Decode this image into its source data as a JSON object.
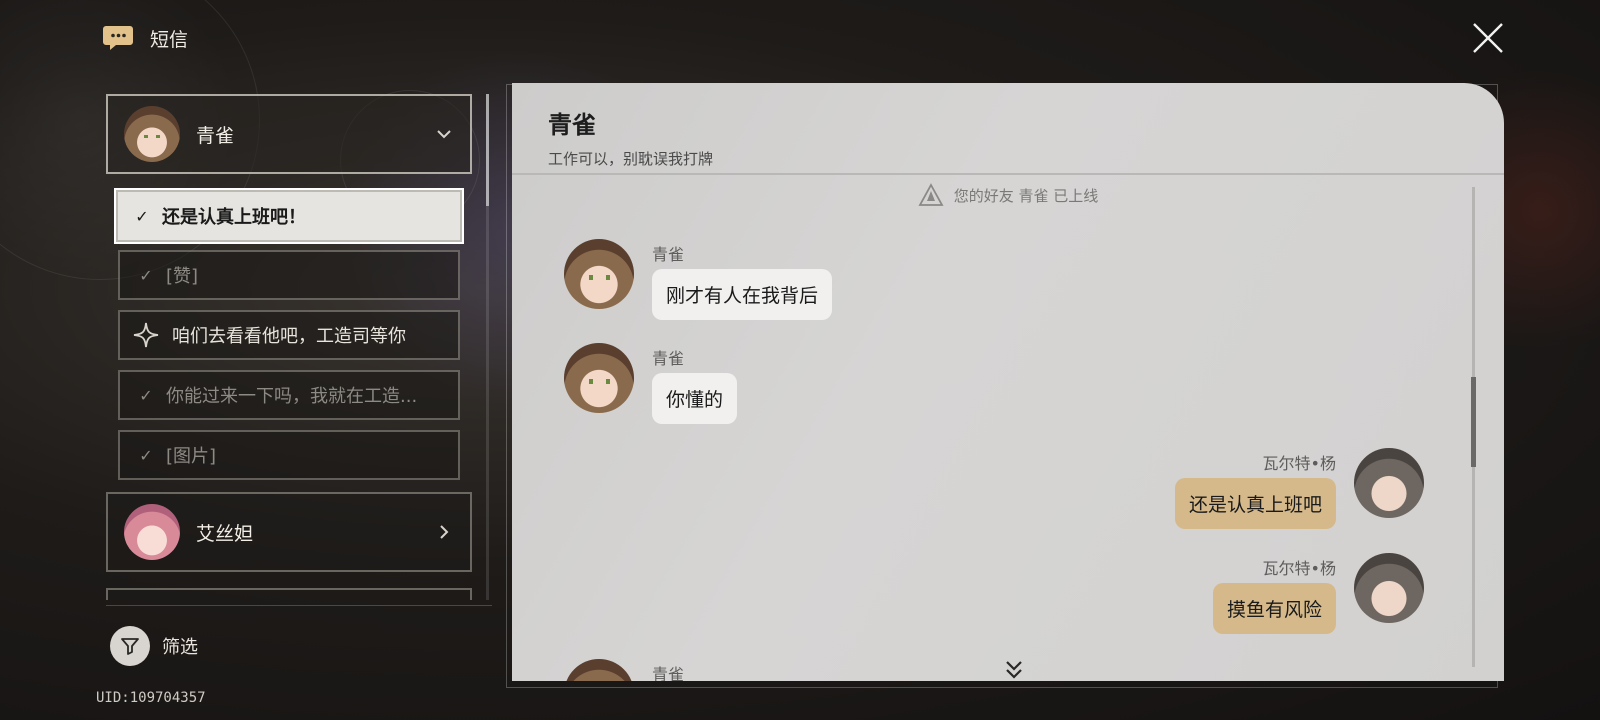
{
  "app": {
    "title": "短信",
    "uid": "UID:109704357"
  },
  "contacts": [
    {
      "name": "青雀",
      "expanded": true
    },
    {
      "name": "艾丝妲",
      "expanded": false
    }
  ],
  "replies": [
    {
      "text": "还是认真上班吧！",
      "state": "selected"
    },
    {
      "text": "[赞]",
      "state": "read"
    },
    {
      "text": "咱们去看看他吧，工造司等你",
      "state": "new"
    },
    {
      "text": "你能过来一下吗，我就在工造...",
      "state": "read"
    },
    {
      "text": "[图片]",
      "state": "read"
    }
  ],
  "filter": {
    "label": "筛选"
  },
  "chat": {
    "name": "青雀",
    "signature": "工作可以，别耽误我打牌",
    "system_note": "您的好友 青雀 已上线",
    "messages": [
      {
        "side": "left",
        "sender": "青雀",
        "text": "刚才有人在我背后"
      },
      {
        "side": "left",
        "sender": "青雀",
        "text": "你懂的"
      },
      {
        "side": "right",
        "sender": "瓦尔特•杨",
        "text": "还是认真上班吧"
      },
      {
        "side": "right",
        "sender": "瓦尔特•杨",
        "text": "摸鱼有风险"
      },
      {
        "side": "left",
        "sender": "青雀",
        "text": ""
      }
    ]
  },
  "colors": {
    "accent_gold": "#d5b98a",
    "icon_gold": "#e2c28a",
    "panel_bg": "#d2d1d0"
  },
  "icons": [
    "message-icon",
    "close-icon",
    "chevron-down-icon",
    "chevron-right-icon",
    "check-icon",
    "star-icon",
    "filter-icon",
    "trailblaze-icon",
    "double-chevron-down-icon"
  ]
}
